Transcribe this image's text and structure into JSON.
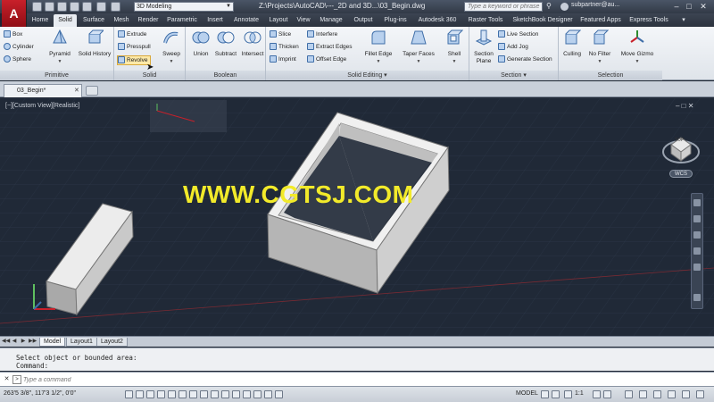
{
  "titlebar": {
    "workspace": "3D Modeling",
    "file_title": "Z:\\Projects\\AutoCAD\\---_2D and 3D...\\03_Begin.dwg",
    "search_placeholder": "Type a keyword or phrase",
    "user": "subpartner@au..."
  },
  "ribbon_tabs": [
    "Home",
    "Solid",
    "Surface",
    "Mesh",
    "Render",
    "Parametric",
    "Insert",
    "Annotate",
    "Layout",
    "View",
    "Manage",
    "Output",
    "Plug-ins",
    "Autodesk 360",
    "Raster Tools",
    "SketchBook Designer",
    "Featured Apps",
    "Express Tools"
  ],
  "active_tab": "Solid",
  "ribbon": {
    "primitive": {
      "label": "Primitive",
      "items": [
        "Box",
        "Cylinder",
        "Sphere"
      ],
      "pyramid": "Pyramid",
      "solid_history": "Solid History"
    },
    "solid": {
      "label": "Solid",
      "items": [
        "Extrude",
        "Presspull",
        "Revolve"
      ],
      "sweep": "Sweep"
    },
    "boolean": {
      "label": "Boolean",
      "union": "Union",
      "subtract": "Subtract",
      "intersect": "Intersect"
    },
    "solid_editing": {
      "label": "Solid Editing",
      "col1": [
        "Slice",
        "Thicken",
        "Imprint"
      ],
      "col2": [
        "Interfere",
        "Extract Edges",
        "Offset Edge"
      ],
      "fillet_edge": "Fillet Edge",
      "taper_faces": "Taper Faces",
      "shell": "Shell"
    },
    "section": {
      "label": "Section",
      "section_plane": "Section Plane",
      "items": [
        "Live Section",
        "Add Jog",
        "Generate Section"
      ]
    },
    "selection": {
      "label": "Selection",
      "culling": "Culling",
      "filter": "No Filter",
      "move_gizmo": "Move Gizmo"
    }
  },
  "file_tab": "03_Begin*",
  "viewport": {
    "label": "[−][Custom View][Realistic]",
    "watermark": "WWW.CGTSJ.COM",
    "wcs": "WCS",
    "cube_face": "TOP"
  },
  "layout_tabs": [
    "Model",
    "Layout1",
    "Layout2"
  ],
  "command": {
    "history": [
      "Select object or bounded area:",
      "Command:"
    ],
    "placeholder": "Type a command"
  },
  "status": {
    "coords": "263'5 3/8\", 117'3 1/2\", 0'0\"",
    "space": "MODEL",
    "scale": "1:1"
  },
  "colors": {
    "viewport_bg": "#202937",
    "watermark": "#f2ea2a",
    "ribbon_bg": "#e8ecf1",
    "app_red": "#c8202a"
  }
}
